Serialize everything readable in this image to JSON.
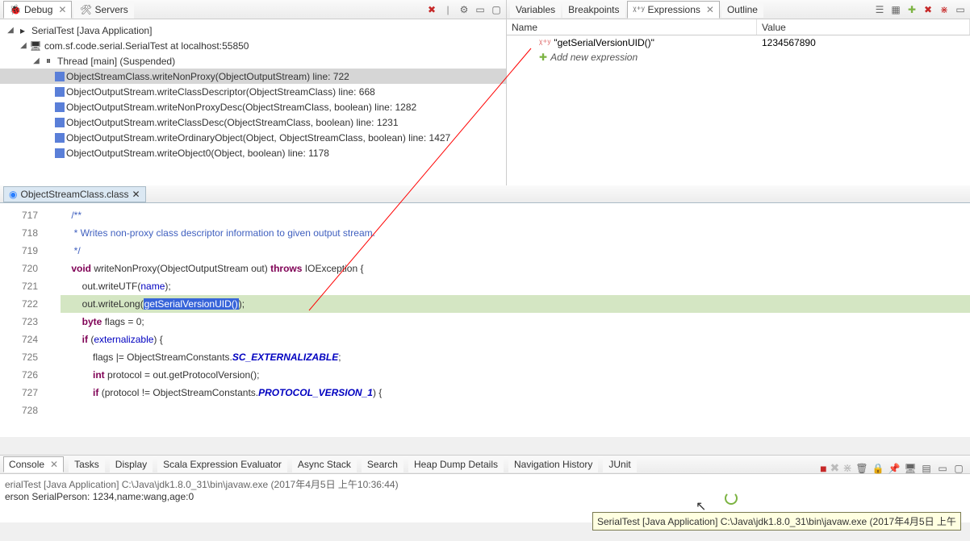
{
  "debug": {
    "tab_label": "Debug",
    "servers_tab": "Servers",
    "tree": {
      "root": "SerialTest [Java Application]",
      "vm": "com.sf.code.serial.SerialTest at localhost:55850",
      "thread": "Thread [main] (Suspended)",
      "frames": [
        "ObjectStreamClass.writeNonProxy(ObjectOutputStream) line: 722",
        "ObjectOutputStream.writeClassDescriptor(ObjectStreamClass) line: 668",
        "ObjectOutputStream.writeNonProxyDesc(ObjectStreamClass, boolean) line: 1282",
        "ObjectOutputStream.writeClassDesc(ObjectStreamClass, boolean) line: 1231",
        "ObjectOutputStream.writeOrdinaryObject(Object, ObjectStreamClass, boolean) line: 1427",
        "ObjectOutputStream.writeObject0(Object, boolean) line: 1178"
      ]
    }
  },
  "right_tabs": {
    "variables": "Variables",
    "breakpoints": "Breakpoints",
    "expressions": "Expressions",
    "outline": "Outline"
  },
  "expressions": {
    "col_name": "Name",
    "col_value": "Value",
    "rows": [
      {
        "expr": "\"getSerialVersionUID()\"",
        "value": "1234567890"
      }
    ],
    "add_new": "Add new expression"
  },
  "editor": {
    "tab": "ObjectStreamClass.class",
    "lines": [
      {
        "n": "717",
        "t": "    /**"
      },
      {
        "n": "718",
        "t": "     * Writes non-proxy class descriptor information to given output stream."
      },
      {
        "n": "719",
        "t": "     */"
      },
      {
        "n": "720",
        "t": "    void writeNonProxy(ObjectOutputStream out) throws IOException {"
      },
      {
        "n": "721",
        "t": "        out.writeUTF(name);"
      },
      {
        "n": "722",
        "t": "        out.writeLong(getSerialVersionUID());"
      },
      {
        "n": "723",
        "t": ""
      },
      {
        "n": "724",
        "t": "        byte flags = 0;"
      },
      {
        "n": "725",
        "t": "        if (externalizable) {"
      },
      {
        "n": "726",
        "t": "            flags |= ObjectStreamConstants.SC_EXTERNALIZABLE;"
      },
      {
        "n": "727",
        "t": "            int protocol = out.getProtocolVersion();"
      },
      {
        "n": "728",
        "t": "            if (protocol != ObjectStreamConstants.PROTOCOL_VERSION_1) {"
      }
    ],
    "highlighted_line": "722",
    "selection": "getSerialVersionUID()"
  },
  "bottom_tabs": {
    "console": "Console",
    "tasks": "Tasks",
    "display": "Display",
    "scala": "Scala Expression Evaluator",
    "async": "Async Stack",
    "search": "Search",
    "heap": "Heap Dump Details",
    "nav": "Navigation History",
    "junit": "JUnit"
  },
  "console": {
    "header": "erialTest [Java Application] C:\\Java\\jdk1.8.0_31\\bin\\javaw.exe (2017年4月5日 上午10:36:44)",
    "line1": "erson SerialPerson: 1234,name:wang,age:0"
  },
  "tooltip": "SerialTest [Java Application] C:\\Java\\jdk1.8.0_31\\bin\\javaw.exe (2017年4月5日 上午"
}
